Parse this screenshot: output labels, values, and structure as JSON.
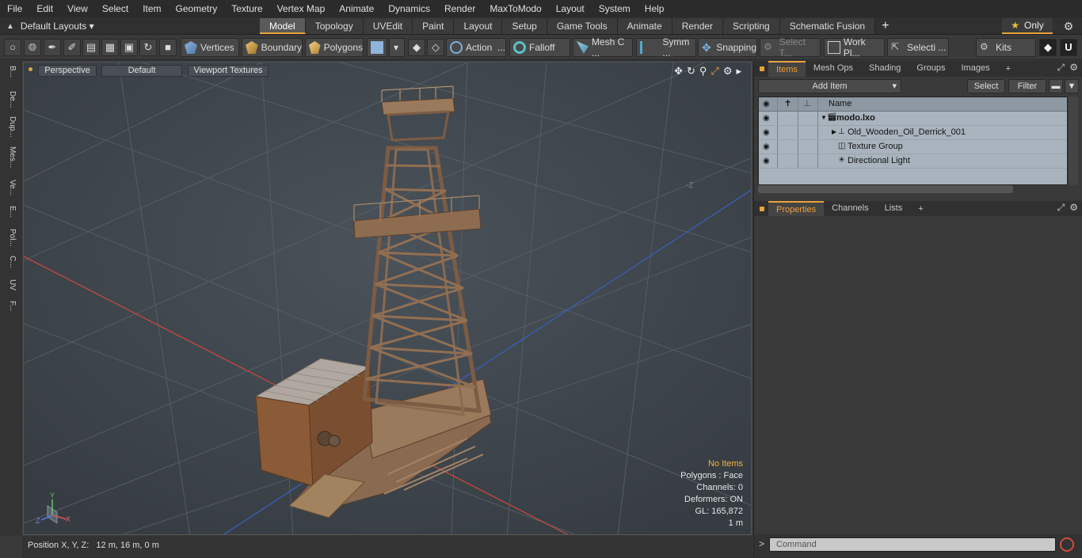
{
  "menu": [
    "File",
    "Edit",
    "View",
    "Select",
    "Item",
    "Geometry",
    "Texture",
    "Vertex Map",
    "Animate",
    "Dynamics",
    "Render",
    "MaxToModo",
    "Layout",
    "System",
    "Help"
  ],
  "layout_selector": "Default Layouts",
  "mode_tabs": [
    "Model",
    "Topology",
    "UVEdit",
    "Paint",
    "Layout",
    "Setup",
    "Game Tools",
    "Animate",
    "Render",
    "Scripting",
    "Schematic Fusion"
  ],
  "active_tab": "Model",
  "only_label": "Only",
  "toolbar": {
    "vertices": "Vertices",
    "boundary": "Boundary",
    "polygons": "Polygons",
    "action": "Action",
    "falloff": "Falloff",
    "mesh_c": "Mesh C ...",
    "symm": "Symm ...",
    "snapping": "Snapping",
    "select_t": "Select T...",
    "work_pl": "Work Pl...",
    "selecti": "Selecti ...",
    "kits": "Kits"
  },
  "left_tabs": [
    "B...",
    "De...",
    "Dup...",
    "Mes...",
    "Ve...",
    "E...",
    "Pol...",
    "C...",
    "UV",
    "F..."
  ],
  "viewport": {
    "perspective": "Perspective",
    "default": "Default",
    "textures": "Viewport Textures",
    "axis_z": "-Z",
    "gizmo_labels": [
      "Y",
      "Z",
      "X"
    ],
    "info": {
      "no_items": "No Items",
      "polygons": "Polygons : Face",
      "channels": "Channels: 0",
      "deformers": "Deformers: ON",
      "gl": "GL: 165,872",
      "scale": "1 m"
    }
  },
  "status": "Position X, Y, Z:   12 m, 16 m, 0 m",
  "right_panel": {
    "top_tabs": [
      "Items",
      "Mesh Ops",
      "Shading",
      "Groups",
      "Images"
    ],
    "add_item": "Add Item",
    "select": "Select",
    "filter": "Filter",
    "col_name": "Name",
    "items": [
      {
        "name": "modo.lxo"
      },
      {
        "name": "Old_Wooden_Oil_Derrick_001"
      },
      {
        "name": "Texture Group"
      },
      {
        "name": "Directional Light"
      }
    ],
    "bottom_tabs": [
      "Properties",
      "Channels",
      "Lists"
    ],
    "command_placeholder": "Command"
  }
}
